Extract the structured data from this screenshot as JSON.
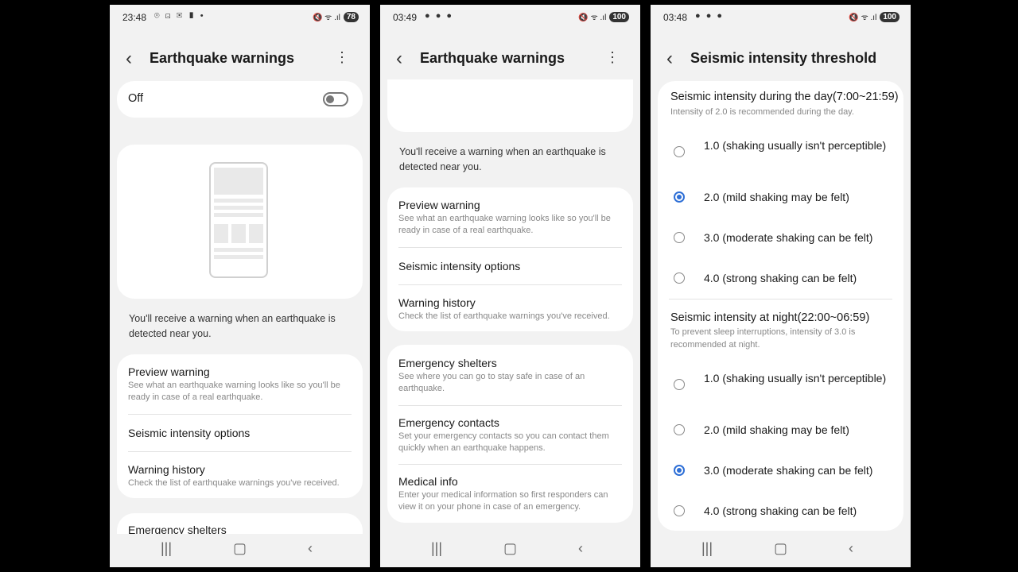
{
  "screen1": {
    "time": "23:48",
    "status_icons": "⌾ ⊡ ✉ ▮ •",
    "battery": "78",
    "title": "Earthquake warnings",
    "toggle_label": "Off",
    "description": "You'll receive a warning when an earthquake is detected near you.",
    "items": [
      {
        "title": "Preview warning",
        "subtitle": "See what an earthquake warning looks like so you'll be ready in case of a real earthquake."
      },
      {
        "title": "Seismic intensity options"
      },
      {
        "title": "Warning history",
        "subtitle": "Check the list of earthquake warnings you've received."
      }
    ],
    "next_item": "Emergency shelters"
  },
  "screen2": {
    "time": "03:49",
    "battery": "100",
    "title": "Earthquake warnings",
    "description": "You'll receive a warning when an earthquake is detected near you.",
    "items": [
      {
        "title": "Preview warning",
        "subtitle": "See what an earthquake warning looks like so you'll be ready in case of a real earthquake."
      },
      {
        "title": "Seismic intensity options"
      },
      {
        "title": "Warning history",
        "subtitle": "Check the list of earthquake warnings you've received."
      }
    ],
    "items2": [
      {
        "title": "Emergency shelters",
        "subtitle": "See where you can go to stay safe in case of an earthquake."
      },
      {
        "title": "Emergency contacts",
        "subtitle": "Set your emergency contacts so you can contact them quickly when an earthquake happens."
      },
      {
        "title": "Medical info",
        "subtitle": "Enter your medical information so first responders can view it on your phone in case of an emergency."
      }
    ]
  },
  "screen3": {
    "time": "03:48",
    "battery": "100",
    "title": "Seismic intensity threshold",
    "day_heading": "Seismic intensity during the day(7:00~21:59)",
    "day_sub": "Intensity of 2.0 is recommended during the day.",
    "night_heading": "Seismic intensity at night(22:00~06:59)",
    "night_sub": "To prevent sleep interruptions, intensity of 3.0 is recommended at night.",
    "day_options": [
      "1.0 (shaking usually isn't perceptible)",
      "2.0 (mild shaking may be felt)",
      "3.0 (moderate shaking can be felt)",
      "4.0 (strong shaking can be felt)"
    ],
    "night_options": [
      "1.0 (shaking usually isn't perceptible)",
      "2.0 (mild shaking may be felt)",
      "3.0 (moderate shaking can be felt)",
      "4.0 (strong shaking can be felt)"
    ],
    "day_selected": "2.0",
    "night_selected": "3.0"
  },
  "status_right": "🔇 ᯤ .ıl",
  "icons": {
    "back": "‹",
    "more": "⋮",
    "recents": "|||",
    "home": "▢",
    "nav_back": "‹"
  },
  "colors": {
    "accent": "#2e6fd6",
    "background": "#f2f2f2",
    "card": "#ffffff"
  }
}
